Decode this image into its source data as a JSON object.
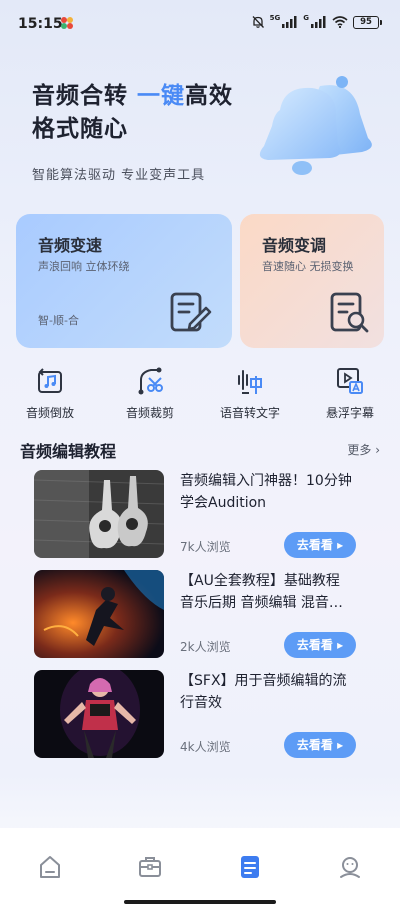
{
  "status_bar": {
    "time": "15:15",
    "network_label_1": "5G",
    "network_label_2": "G",
    "battery": "95"
  },
  "hero": {
    "title_part1": "音频合转 ",
    "title_accent": "一键",
    "title_part2": "高效格式随心",
    "subtitle": "智能算法驱动 专业变声工具"
  },
  "feature_cards": [
    {
      "title": "音频变速",
      "subtitle": "声浪回响 立体环绕",
      "tag": "智-顺-合",
      "icon": "edit-document-icon"
    },
    {
      "title": "音频变调",
      "subtitle": "音速随心 无损变换",
      "icon": "search-document-icon"
    }
  ],
  "tools": [
    {
      "label": "音频倒放",
      "icon": "music-reverse-icon"
    },
    {
      "label": "音频裁剪",
      "icon": "scissors-icon"
    },
    {
      "label": "语音转文字",
      "icon": "voice-to-text-icon"
    },
    {
      "label": "悬浮字幕",
      "icon": "floating-subtitle-icon"
    }
  ],
  "section": {
    "title": "音频编辑教程",
    "more": "更多 ›"
  },
  "articles": [
    {
      "title": "音频编辑入门神器！10分钟学会Audition",
      "views": "7k人浏览",
      "button": "去看看 ▸"
    },
    {
      "title": "【AU全套教程】基础教程 音乐后期 音频编辑 混音…",
      "views": "2k人浏览",
      "button": "去看看 ▸"
    },
    {
      "title": "【SFX】用于音频编辑的流行音效",
      "views": "4k人浏览",
      "button": "去看看 ▸"
    }
  ],
  "bottom_nav": [
    {
      "icon": "home-icon",
      "active": false
    },
    {
      "icon": "toolbox-icon",
      "active": false
    },
    {
      "icon": "document-icon",
      "active": true
    },
    {
      "icon": "profile-icon",
      "active": false
    }
  ],
  "colors": {
    "accent": "#4a8af5",
    "button": "#5d9cf6",
    "card_speed": "#a9cbff",
    "card_pitch": "#fbd9c6",
    "nav_active": "#3d7cf0",
    "nav_inactive": "#8a8f99"
  }
}
